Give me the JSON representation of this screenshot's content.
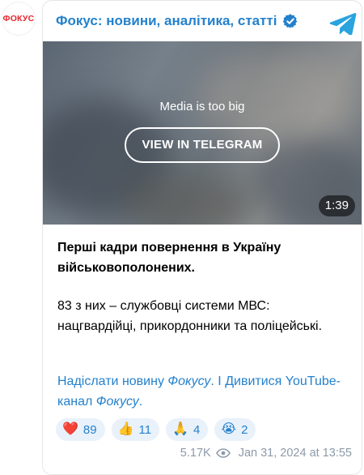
{
  "channel": {
    "avatar_text": "ФОКУС",
    "title": "Фокус: новини, аналітика, статті"
  },
  "media": {
    "notice": "Media is too big",
    "button_label": "VIEW IN TELEGRAM",
    "duration": "1:39"
  },
  "post": {
    "title": "Перші кадри повернення в Україну військовополонених.",
    "body": "83 з них – службовці системи МВС: нацгвардійці, прикордонники та поліцейські.",
    "link1_prefix": "Надіслати новину ",
    "link1_em": "Фокусу",
    "link1_suffix": ".",
    "separator": " І ",
    "link2_prefix": "Дивитися YouTube-канал ",
    "link2_em": "Фокусу",
    "link2_suffix": "."
  },
  "reactions": [
    {
      "emoji": "❤️",
      "count": "89"
    },
    {
      "emoji": "👍",
      "count": "11"
    },
    {
      "emoji": "🙏",
      "count": "4"
    },
    {
      "emoji": "😭",
      "count": "2"
    }
  ],
  "meta": {
    "views": "5.17K",
    "date": "Jan 31, 2024 at 13:55"
  },
  "colors": {
    "accent": "#2481cc",
    "brand_red": "#e4252c",
    "reaction_bg": "#e9f1fa",
    "meta_gray": "#8c9aa8"
  },
  "icons": {
    "verified": "verified-badge-icon",
    "telegram": "telegram-logo-icon",
    "views": "eye-icon"
  }
}
